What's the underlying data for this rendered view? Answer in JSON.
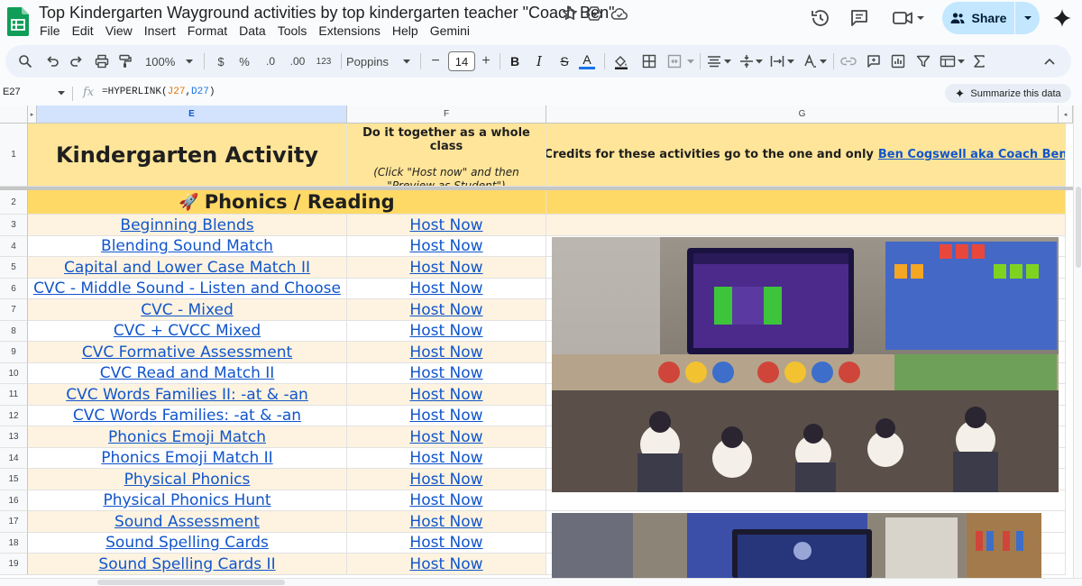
{
  "app": {
    "logo_icon": "google-sheets-logo-icon",
    "document_title": "Top Kindergarten Wayground activities by top kindergarten teacher \"Coach Ben\"",
    "title_icons": [
      "star-icon",
      "move-to-drive-icon",
      "cloud-saved-icon"
    ],
    "menu": [
      "File",
      "Edit",
      "View",
      "Insert",
      "Format",
      "Data",
      "Tools",
      "Extensions",
      "Help",
      "Gemini"
    ],
    "share_label": "Share",
    "right_icons": [
      "version-history-icon",
      "comments-icon",
      "meet-icon",
      "gemini-icon"
    ]
  },
  "toolbar": {
    "zoom": "100%",
    "currency": "$",
    "percent": "%",
    "decrease_decimals": ".0",
    "increase_decimals": ".00",
    "number_format": "123",
    "font": "Poppins",
    "font_size": "14",
    "minus": "−",
    "plus": "+",
    "bold": "B",
    "italic": "I",
    "strike": "S",
    "text_color_letter": "A",
    "text_color_underline": "#1a73e8"
  },
  "formula_bar": {
    "cell_ref": "E27",
    "fx": "fx",
    "formula_prefix": "=HYPERLINK(",
    "arg1": "J27",
    "comma": ",",
    "arg2": "D27",
    "formula_suffix": ")",
    "summarize_label": "Summarize this data"
  },
  "grid": {
    "columns": [
      "E",
      "F",
      "G"
    ],
    "selected_column": "E",
    "header_row": {
      "row_number": "1",
      "title": "Kindergarten Activity",
      "together": "Do it together as a whole class",
      "click_note_line1": "(Click \"Host now\" and then",
      "click_note_line2": "\"Preview as Student\")",
      "credits_text": "Credits for these activities go to the one and only",
      "credits_link": "Ben Cogswell aka Coach Ben"
    },
    "section_row": {
      "row_number": "2",
      "emoji": "🚀",
      "title": "Phonics / Reading"
    },
    "rows": [
      {
        "num": "3",
        "activity": "Beginning Blends",
        "host": "Host Now"
      },
      {
        "num": "4",
        "activity": "Blending Sound Match",
        "host": "Host Now"
      },
      {
        "num": "5",
        "activity": "Capital and Lower Case Match II",
        "host": "Host Now"
      },
      {
        "num": "6",
        "activity": "CVC - Middle Sound - Listen and Choose",
        "host": "Host Now"
      },
      {
        "num": "7",
        "activity": "CVC - Mixed",
        "host": "Host Now"
      },
      {
        "num": "8",
        "activity": "CVC + CVCC Mixed",
        "host": "Host Now"
      },
      {
        "num": "9",
        "activity": "CVC Formative Assessment",
        "host": "Host Now"
      },
      {
        "num": "10",
        "activity": "CVC Read and Match II",
        "host": "Host Now"
      },
      {
        "num": "11",
        "activity": "CVC Words Families II: -at & -an",
        "host": "Host Now"
      },
      {
        "num": "12",
        "activity": "CVC Words Families: -at & -an",
        "host": "Host Now"
      },
      {
        "num": "13",
        "activity": "Phonics Emoji Match",
        "host": "Host Now"
      },
      {
        "num": "14",
        "activity": "Phonics Emoji Match II",
        "host": "Host Now"
      },
      {
        "num": "15",
        "activity": "Physical Phonics",
        "host": "Host Now"
      },
      {
        "num": "16",
        "activity": "Physical Phonics Hunt",
        "host": "Host Now"
      },
      {
        "num": "17",
        "activity": "Sound Assessment",
        "host": "Host Now"
      },
      {
        "num": "18",
        "activity": "Sound Spelling Cards",
        "host": "Host Now"
      },
      {
        "num": "19",
        "activity": "Sound Spelling Cards II",
        "host": "Host Now"
      }
    ],
    "colors": {
      "header_fill": "#ffe599",
      "section_fill": "#ffd966",
      "odd_row_fill": "#fdf3e0",
      "link": "#1155cc"
    }
  }
}
